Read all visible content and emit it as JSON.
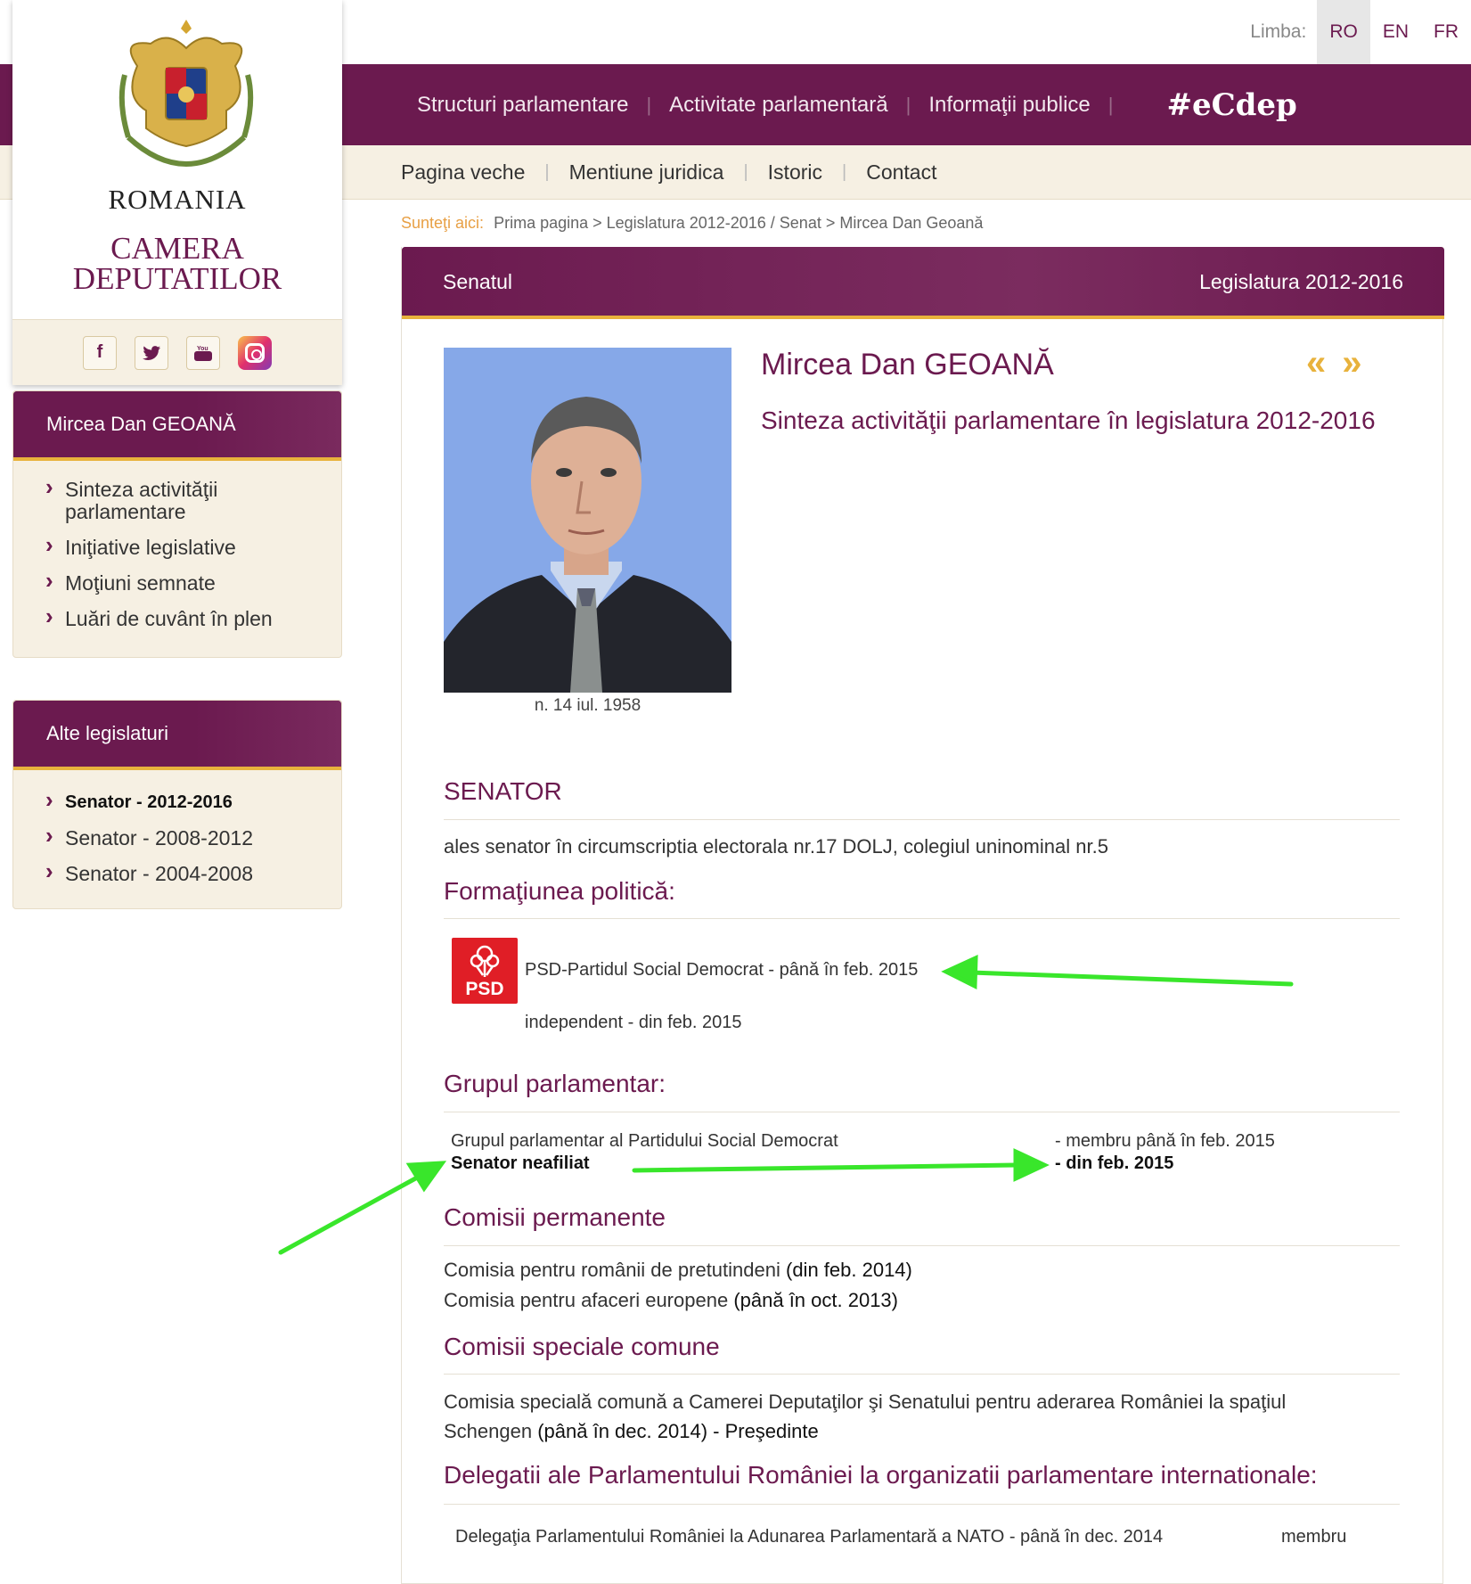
{
  "lang": {
    "label": "Limba:",
    "options": [
      "RO",
      "EN",
      "FR"
    ],
    "active": "RO"
  },
  "main_nav": {
    "items": [
      "Structuri parlamentare",
      "Activitate parlamentară",
      "Informaţii publice"
    ],
    "brand": "#eCdep"
  },
  "sub_nav": {
    "items": [
      "Pagina veche",
      "Mentiune juridica",
      "Istoric",
      "Contact"
    ]
  },
  "logo": {
    "country": "ROMANIA",
    "line1": "CAMERA",
    "line2": "DEPUTATILOR"
  },
  "social": [
    "facebook-icon",
    "twitter-icon",
    "youtube-icon",
    "instagram-icon"
  ],
  "sidebar_person": {
    "title": "Mircea Dan GEOANĂ",
    "items": [
      "Sinteza activităţii parlamentare",
      "Iniţiative legislative",
      "Moţiuni semnate",
      "Luări de cuvânt în plen"
    ]
  },
  "sidebar_legislatures": {
    "title": "Alte legislaturi",
    "items": [
      "Senator - 2012-2016",
      "Senator - 2008-2012",
      "Senator - 2004-2008"
    ],
    "current_index": 0
  },
  "breadcrumb": {
    "here": "Sunteţi aici:",
    "path": "Prima pagina > Legislatura 2012-2016 / Senat > Mircea Dan Geoană"
  },
  "panel": {
    "left_title": "Senatul",
    "right_title": "Legislatura 2012-2016"
  },
  "person": {
    "name": "Mircea Dan GEOANĂ",
    "synthesis": "Sinteza activităţii parlamentare în legislatura 2012-2016",
    "birth": "n. 14 iul. 1958",
    "prev_arrow": "«",
    "next_arrow": "»"
  },
  "senator": {
    "title": "SENATOR",
    "elected": "ales senator în circumscriptia electorala nr.17 DOLJ, colegiul uninominal nr.5"
  },
  "political": {
    "title": "Formaţiunea politică:",
    "logo_text": "PSD",
    "party1": "PSD-Partidul Social Democrat - până în feb. 2015",
    "party2": "independent  - din feb. 2015"
  },
  "group": {
    "title": "Grupul parlamentar:",
    "row1_name": "Grupul parlamentar al Partidului Social Democrat",
    "row1_status": "- membru până în feb. 2015",
    "row2_name": "Senator neafiliat",
    "row2_status": "- din feb. 2015"
  },
  "permanent": {
    "title": "Comisii permanente",
    "item1": "Comisia pentru românii de pretutindeni",
    "item1_period": "(din feb. 2014)",
    "item2": "Comisia pentru afaceri europene",
    "item2_period": "(până în oct. 2013)"
  },
  "special": {
    "title": "Comisii speciale comune",
    "line1": "Comisia specială comună a Camerei Deputaţilor şi Senatului pentru aderarea României la spaţiul",
    "line2_name": "Schengen",
    "line2_rest": "(până în dec. 2014) - Preşedinte"
  },
  "delegations": {
    "title": "Delegatii ale Parlamentului României la organizatii parlamentare internationale:",
    "item": "Delegaţia Parlamentului României la Adunarea Parlamentară a NATO  - până în dec. 2014",
    "role": "membru"
  },
  "colors": {
    "accent": "#6b1a4f",
    "gold": "#e8b23c",
    "annotation": "#39e62b"
  }
}
